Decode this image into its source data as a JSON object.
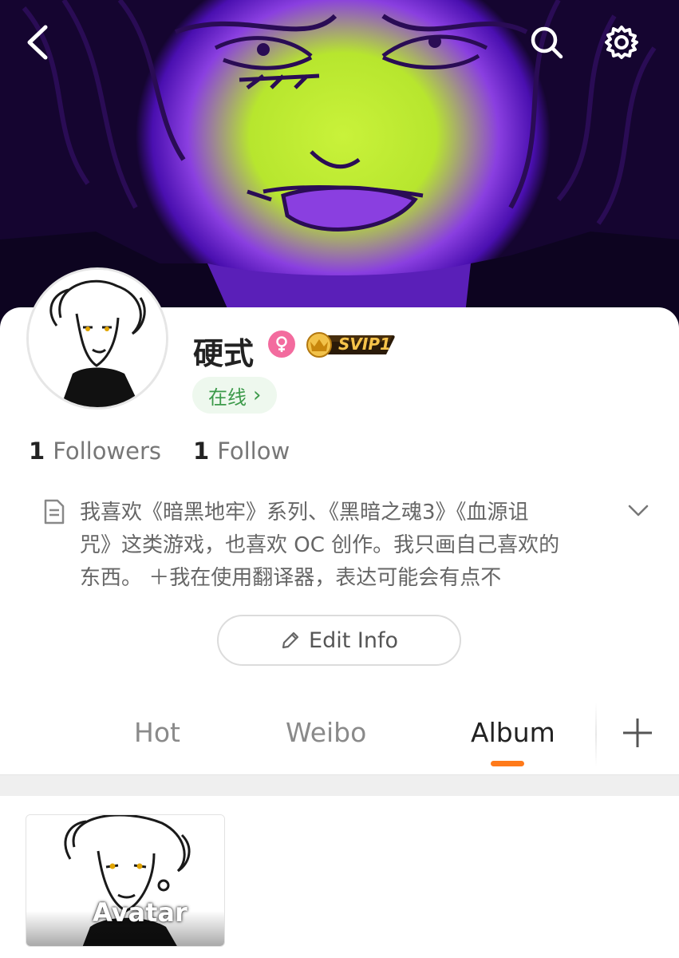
{
  "header": {
    "icons": [
      "back-icon",
      "search-icon",
      "settings-icon"
    ]
  },
  "profile": {
    "username": "硬式",
    "gender_icon": "female-icon",
    "vip_label": "SVIP1",
    "status": "在线",
    "status_chevron": "›",
    "followers_count": "1",
    "followers_label": "Followers",
    "follow_count": "1",
    "follow_label": "Follow",
    "bio_line1": "我喜欢《暗黑地牢》系列、《黑暗之魂3》《血源诅",
    "bio_line2": "咒》这类游戏，也喜欢 OC 创作。我只画自己喜欢的",
    "bio_line3": "东西。 ＋我在使用翻译器，表达可能会有点不",
    "edit_label": "Edit Info"
  },
  "tabs": [
    {
      "label": "Hot",
      "active": false
    },
    {
      "label": "Weibo",
      "active": false
    },
    {
      "label": "Album",
      "active": true
    }
  ],
  "album": {
    "items": [
      {
        "label": "Avatar"
      }
    ]
  },
  "colors": {
    "accent": "#ff7a1a",
    "status_bg": "#eef8ee",
    "status_text": "#3c9a4a",
    "gender": "#f36b9e",
    "vip_gold": "#d9a021"
  }
}
